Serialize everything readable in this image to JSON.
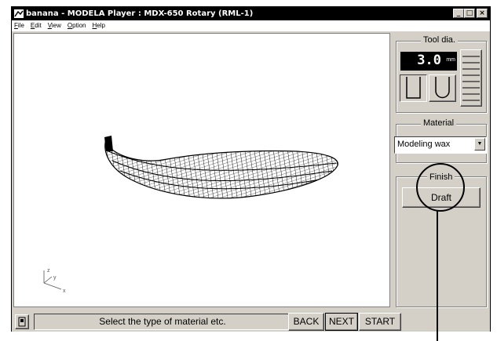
{
  "window": {
    "title": "banana - MODELA Player  : MDX-650 Rotary (RML-1)",
    "controls": [
      "_",
      "□",
      "×"
    ]
  },
  "menu": [
    "File",
    "Edit",
    "View",
    "Option",
    "Help"
  ],
  "axes": {
    "z": "z",
    "y": "y",
    "x": "x"
  },
  "tool": {
    "group_label": "Tool dia.",
    "value": "3.0",
    "unit": "mm"
  },
  "material": {
    "group_label": "Material",
    "selected": "Modeling wax"
  },
  "finish": {
    "group_label": "Finish",
    "button_label": "Draft"
  },
  "statusbar": {
    "message": "Select the type of material etc.",
    "back_label": "BACK",
    "next_label": "NEXT",
    "start_label": "START"
  }
}
